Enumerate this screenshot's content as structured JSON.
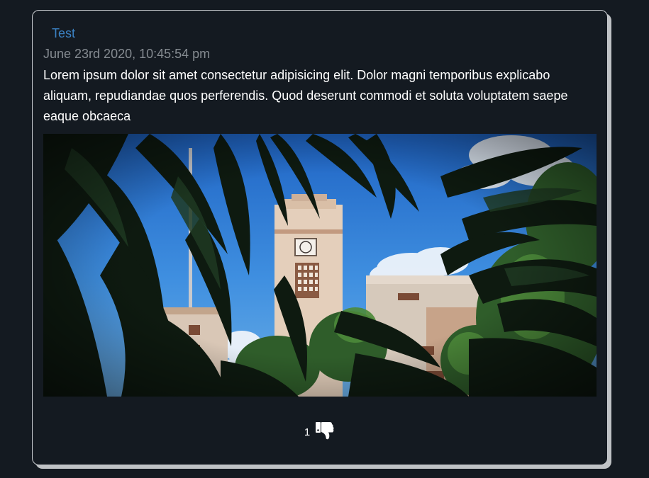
{
  "post": {
    "author": "Test",
    "timestamp": "June 23rd 2020, 10:45:54 pm",
    "body": "Lorem ipsum dolor sit amet consectetur adipisicing elit. Dolor magni temporibus explicabo aliquam, repudiandae quos perferendis. Quod deserunt commodi et soluta voluptatem saepe eaque obcaeca",
    "image": {
      "subject": "clock tower building seen through dark leaves under blue sky"
    },
    "reactions": {
      "dislike_count": "1",
      "dislike_icon": "thumbs-down-icon"
    }
  },
  "colors": {
    "background": "#141a21",
    "card_border": "#c9ccd0",
    "card_shadow": "#bfc2c5",
    "author_link": "#3b82c4",
    "timestamp": "#858b91",
    "body_text": "#ffffff"
  }
}
